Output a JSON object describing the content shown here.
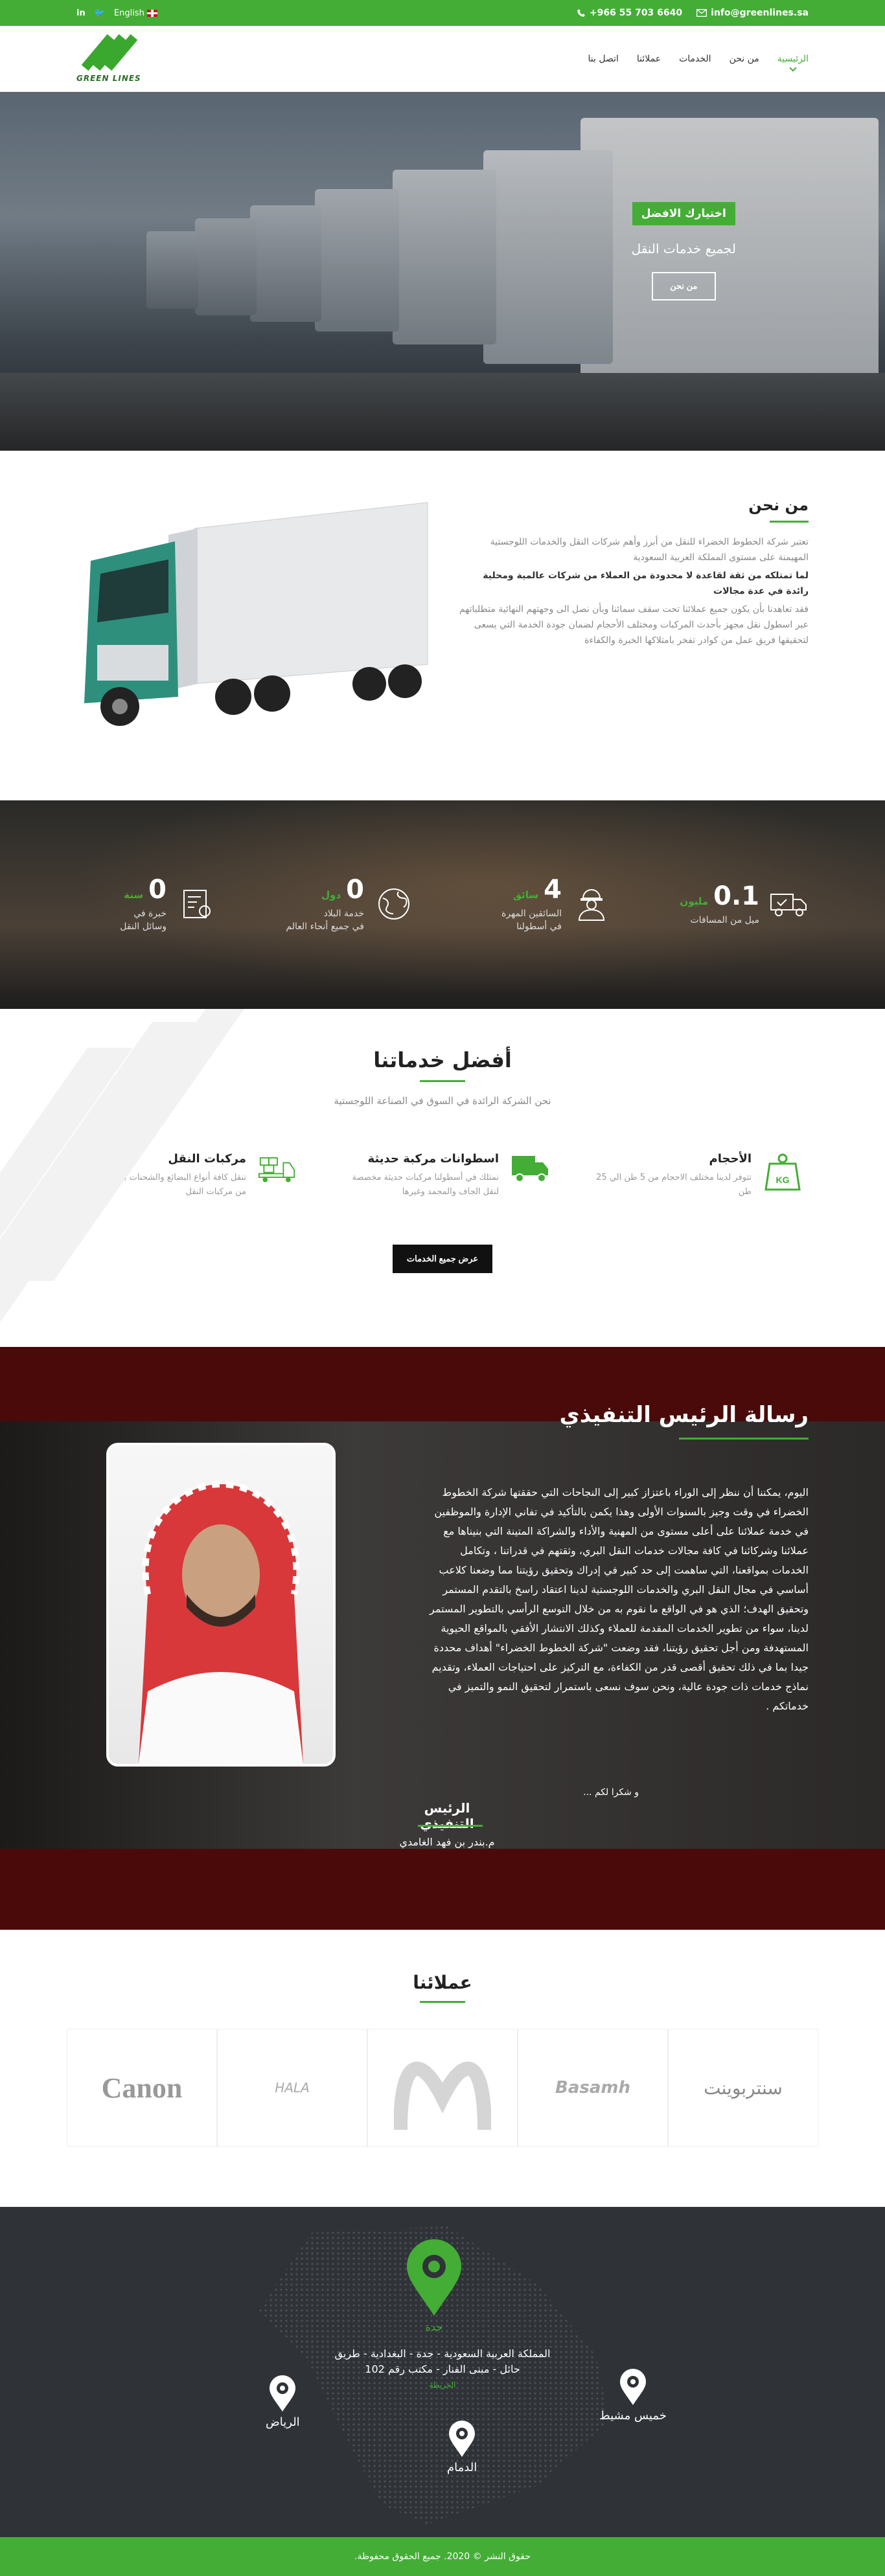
{
  "topbar": {
    "phone": "+966 55 703 6640",
    "email": "info@greenlines.sa",
    "language": "English"
  },
  "brand": {
    "name": "GREEN LINES"
  },
  "nav": {
    "items": [
      {
        "label": "الرئيسية"
      },
      {
        "label": "من نحن"
      },
      {
        "label": "الخدمات"
      },
      {
        "label": "عملائنا"
      },
      {
        "label": "اتصل بنا"
      }
    ]
  },
  "hero": {
    "badge": "اختيارك الافضل",
    "title": "لجميع خدمات النقل",
    "button": "من نحن"
  },
  "about": {
    "title": "من نحن",
    "p1": "تعتبر شركة الخطوط الخضراء للنقل من أبرز وأهم شركات النقل والخدمات اللوجستية المهيمنة على مستوى المملكة العربية السعودية",
    "p2": "لما تمتلكه من ثقة لقاعدة لا محدودة من العملاء من شركات عالمية ومحلية رائدة في عدة مجالات",
    "p3": "فقد تعاهدنا بأن يكون جميع عملائنا تحت سقف سمائنا وبأن نصل الى وجهتهم النهائية متطلباتهم عبر اسطول نقل مجهز بأحدث المركبات ومختلف الأحجام لضمان جودة الخدمة التي يسعى لتحقيقها فريق عمل من كوادر تفخر بامتلاكها الخبرة والكفاءة"
  },
  "stats": [
    {
      "num": "0.1",
      "unit": "مليون",
      "label1": "ميل من المسافات",
      "label2": ""
    },
    {
      "num": "4",
      "unit": "سائق",
      "label1": "السائقين المهرة",
      "label2": "في أسطولنا"
    },
    {
      "num": "0",
      "unit": "دول",
      "label1": "خدمة البلاد",
      "label2": "في جميع أنحاء العالم"
    },
    {
      "num": "0",
      "unit": "سنة",
      "label1": "خبرة في",
      "label2": "وسائل النقل"
    }
  ],
  "services": {
    "title": "أفضل خدماتنا",
    "subtitle": "نحن الشركة الرائدة في السوق في الصناعة اللوجستية",
    "items": [
      {
        "title": "الأحجام",
        "desc": "تتوفر لدينا مختلف الاحجام من 5 طن الي 25 طن"
      },
      {
        "title": "اسطوانات مركبة حديثة",
        "desc": "نمتلك في أسطولنا مركبات حديثة مخصصة لنقل الجاف والمجمد وغيرها"
      },
      {
        "title": "مركبات النقل",
        "desc": "ننقل كافة أنواع البضائع والشحنات بما يناسبها من مركبات النقل"
      }
    ],
    "button": "عرض جميع الخدمات"
  },
  "ceo": {
    "title": "رسالة الرئيس التنفيذي",
    "message": "اليوم، يمكننا أن ننظر إلى الوراء باعتزاز كبير إلى النجاحات التي حققتها شركة الخطوط الخضراء في وقت وجيز بالسنوات الأولى وهذا يكمن بالتأكيد في تفاني الإدارة والموظفين في خدمة عملائنا على أعلى مستوى من المهنية والأداء والشراكة المتينة التي بنيناها مع عملائنا وشركائنا في كافة مجالات خدمات النقل البري، وثقتهم في قدراتنا ، وتكامل الخدمات بمواقعنا، التي ساهمت إلى حد كبير في إدراك وتحقيق رؤيتنا مما وضعنا كلاعب أساسي في مجال النقل البري والخدمات اللوجستية لدينا اعتقاد راسخ بالتقدم المستمر وتحقيق الهدف؛ الذي هو في الواقع ما نقوم به من خلال التوسع الرأسي بالتطوير المستمر لدينا، سواء من تطوير الخدمات المقدمة للعملاء وكذلك الانتشار الأفقي بالمواقع الحيوية المستهدفة ومن أجل تحقيق رؤيتنا، فقد وضعت \"شركة الخطوط الخضراء\" أهداف محددة جيدا بما في ذلك تحقيق أقصى قدر من الكفاءة، مع التركيز على احتياجات العملاء، وتقديم نماذج خدمات ذات جودة عالية، ونحن سوف نسعى باستمرار لتحقيق النمو والتميز في خدماتكم .",
    "thanks": "و شكرا لكم ...",
    "role": "الرئيس التنفيذي",
    "name": "م.بندر بن فهد الغامدي"
  },
  "clients": {
    "title": "عملائنا",
    "logos": [
      "سنتربوينت",
      "Basamh",
      "McDonald's",
      "HALA",
      "Canon"
    ]
  },
  "locations": {
    "main": "جدة",
    "address1": "المملكة العربية السعودية - جدة - البغدادية - طريق",
    "address2": "حائل - مبنى الفنار - مكتب رقم 102",
    "map_link": "الخريطة",
    "cities": [
      "الرياض",
      "خميس مشيط",
      "الدمام"
    ]
  },
  "footer": {
    "copyright": "حقوق النشر © 2020. جميع الحقوق محفوظة."
  },
  "colors": {
    "accent": "#44ad36",
    "dark": "#2f3338",
    "maroon": "#4a0a0a"
  }
}
